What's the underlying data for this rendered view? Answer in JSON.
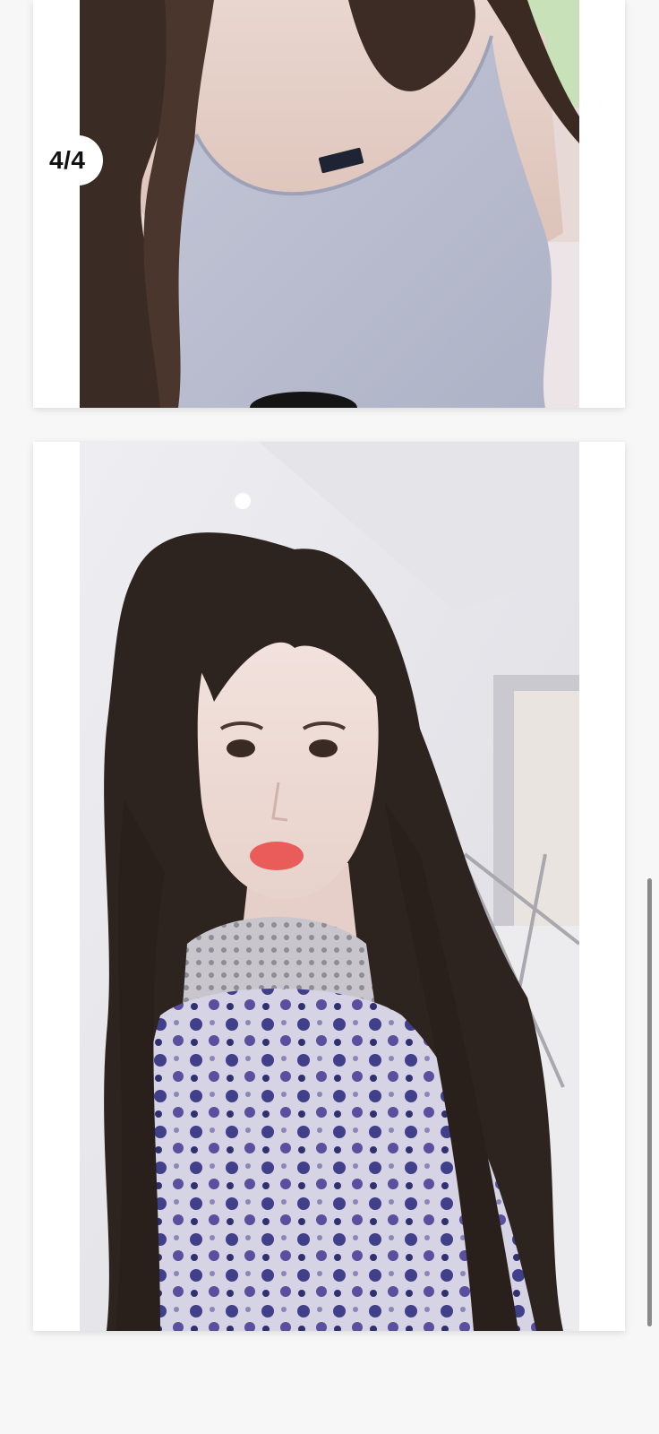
{
  "gallery": {
    "counter": "4/4",
    "photos": [
      {
        "name": "gray-tank-top-photo"
      },
      {
        "name": "floral-top-selfie-photo"
      }
    ]
  },
  "colors": {
    "background": "#f7f7f7",
    "card": "#ffffff",
    "scrollbar": "#8a8a8a"
  }
}
